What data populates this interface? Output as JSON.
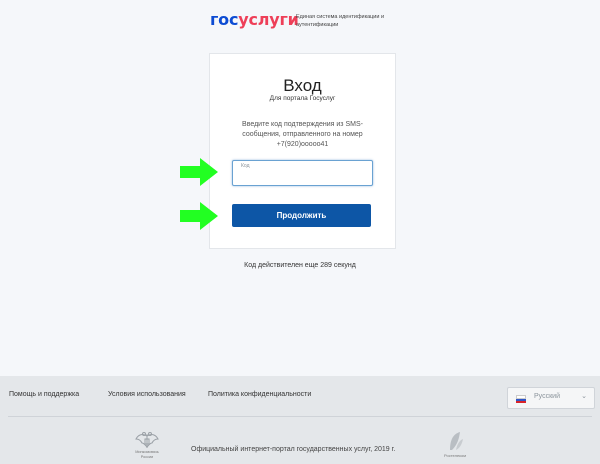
{
  "header": {
    "logo_part1": "гос",
    "logo_part2": "услуги",
    "system_name": "Единая система идентификации и аутентификации"
  },
  "card": {
    "title": "Вход",
    "subtitle": "Для портала Госуслуг",
    "message": "Введите код подтверждения из SMS-сообщения, отправленного на номер +7(920)ооооо41",
    "code_field": {
      "label": "Код",
      "value": ""
    },
    "continue_label": "Продолжить"
  },
  "timer_text": "Код действителен еще 289 секунд",
  "footer": {
    "links": [
      "Помощь и поддержка",
      "Условия использования",
      "Политика конфиденциальности"
    ],
    "language": "Русский",
    "emblem_caption": "Минкомсвязь России",
    "official_text": "Официальный интернет-портал государственных услуг, 2019 г.",
    "rt_caption": "Ростелеком"
  },
  "colors": {
    "brand_blue": "#0d4cd3",
    "brand_red": "#ee3f58",
    "button": "#0d56a6",
    "arrow": "#22ff22"
  },
  "icons": [
    "green-arrow-icon",
    "russian-flag-icon",
    "chevron-down-icon",
    "coat-of-arms-icon",
    "rostelecom-logo-icon"
  ]
}
